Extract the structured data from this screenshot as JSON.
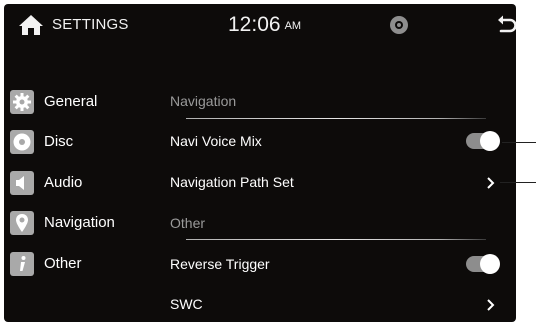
{
  "status_bar": {
    "title": "SETTINGS",
    "time": "12:06",
    "ampm": "AM",
    "icons": [
      "home-icon",
      "disc-status-icon",
      "back-icon"
    ]
  },
  "sidebar": {
    "items": [
      {
        "label": "General",
        "icon": "gear-icon"
      },
      {
        "label": "Disc",
        "icon": "disc-icon"
      },
      {
        "label": "Audio",
        "icon": "speaker-icon"
      },
      {
        "label": "Navigation",
        "icon": "map-pin-icon"
      },
      {
        "label": "Other",
        "icon": "info-icon"
      }
    ]
  },
  "content": {
    "sections": [
      {
        "header": "Navigation",
        "rows": [
          {
            "label": "Navi Voice Mix",
            "control": "toggle",
            "state": "on"
          },
          {
            "label": "Navigation Path Set",
            "control": "chevron"
          }
        ]
      },
      {
        "header": "Other",
        "rows": [
          {
            "label": "Reverse Trigger",
            "control": "toggle",
            "state": "on"
          },
          {
            "label": "SWC",
            "control": "chevron"
          }
        ]
      }
    ]
  },
  "colors": {
    "background": "#0d0b0a",
    "text": "#ffffff",
    "section_header": "#9a9a9a",
    "icon_tile": "#a9a9a9",
    "toggle_track": "#8d8d8d"
  }
}
